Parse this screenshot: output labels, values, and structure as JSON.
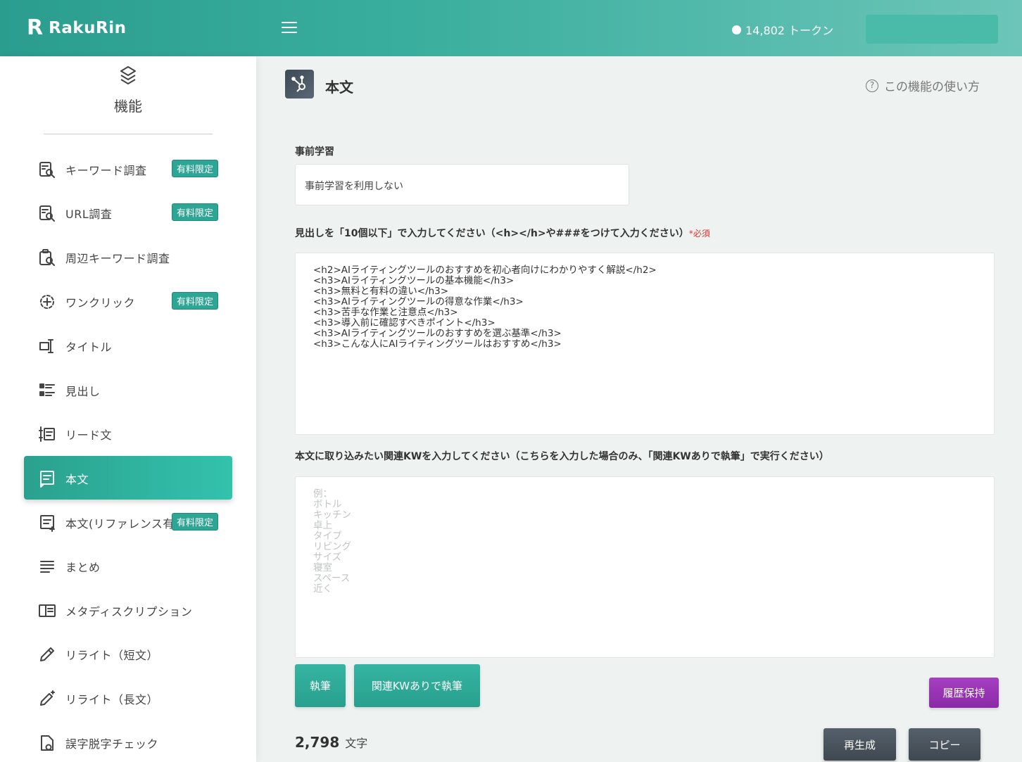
{
  "header": {
    "logo_mark": "R",
    "logo_text": "RakuRin",
    "tokens": "14,802 トークン"
  },
  "sidebar": {
    "heading": "機能",
    "items": [
      {
        "label": "キーワード調査",
        "badge": "有料限定",
        "icon": "keyword-search-icon"
      },
      {
        "label": "URL調査",
        "badge": "有料限定",
        "icon": "url-search-icon"
      },
      {
        "label": "周辺キーワード調査",
        "badge": "",
        "icon": "related-keyword-icon"
      },
      {
        "label": "ワンクリック",
        "badge": "有料限定",
        "icon": "one-click-icon"
      },
      {
        "label": "タイトル",
        "badge": "",
        "icon": "title-icon"
      },
      {
        "label": "見出し",
        "badge": "",
        "icon": "headings-icon"
      },
      {
        "label": "リード文",
        "badge": "",
        "icon": "lead-text-icon"
      },
      {
        "label": "本文",
        "badge": "",
        "icon": "body-text-icon"
      },
      {
        "label": "本文(リファレンス有)",
        "badge": "有料限定",
        "icon": "body-reference-icon"
      },
      {
        "label": "まとめ",
        "badge": "",
        "icon": "summary-icon"
      },
      {
        "label": "メタディスクリプション",
        "badge": "",
        "icon": "meta-description-icon"
      },
      {
        "label": "リライト（短文）",
        "badge": "",
        "icon": "rewrite-short-icon"
      },
      {
        "label": "リライト（長文）",
        "badge": "",
        "icon": "rewrite-long-icon"
      },
      {
        "label": "誤字脱字チェック",
        "badge": "",
        "icon": "typo-check-icon"
      }
    ],
    "active_index": 7
  },
  "main": {
    "title": "本文",
    "help": "この機能の使い方",
    "pretraining_label": "事前学習",
    "pretraining_value": "事前学習を利用しない",
    "headings_label": "見出しを「10個以下」で入力してください（<h></h>や###をつけて入力ください）",
    "required": "*必須",
    "headings_value": "<h2>AIライティングツールのおすすめを初心者向けにわかりやすく解説</h2>\n<h3>AIライティングツールの基本機能</h3>\n<h3>無料と有料の違い</h3>\n<h3>AIライティングツールの得意な作業</h3>\n<h3>苦手な作業と注意点</h3>\n<h3>導入前に確認すべきポイント</h3>\n<h3>AIライティングツールのおすすめを選ぶ基準</h3>\n<h3>こんな人にAIライティングツールはおすすめ</h3>",
    "kw_label": "本文に取り込みたい関連KWを入力してください（こちらを入力した場合のみ、「関連KWありで執筆」で実行ください）",
    "kw_placeholder": "例：\nボトル\nキッチン\n卓上\nタイプ\nリビング\nサイズ\n寝室\nスペース\n近く",
    "btn_write": "執筆",
    "btn_write_kw": "関連KWありで執筆",
    "btn_history": "履歴保持",
    "char_count": "2,798",
    "char_unit": "文字",
    "btn_regen": "再生成",
    "btn_copy": "コピー"
  }
}
